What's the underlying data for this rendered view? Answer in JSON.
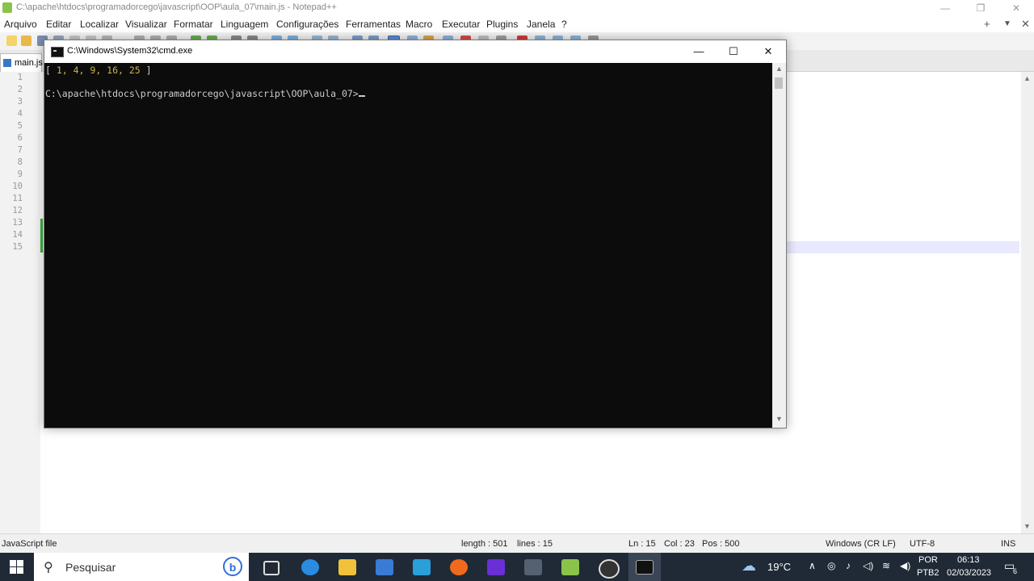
{
  "npp": {
    "title": "C:\\apache\\htdocs\\programadorcego\\javascript\\OOP\\aula_07\\main.js - Notepad++",
    "menu": [
      "Arquivo",
      "Editar",
      "Localizar",
      "Visualizar",
      "Formatar",
      "Linguagem",
      "Configurações",
      "Ferramentas",
      "Macro",
      "Executar",
      "Plugins",
      "Janela",
      "?"
    ],
    "menu_right": [
      "+",
      "▼",
      "✕"
    ],
    "tab_label": "main.js",
    "line_numbers": [
      "1",
      "2",
      "3",
      "4",
      "5",
      "6",
      "7",
      "8",
      "9",
      "10",
      "11",
      "12",
      "13",
      "14",
      "15"
    ],
    "status": {
      "filetype": "JavaScript file",
      "length": "length : 501",
      "lines": "lines : 15",
      "ln": "Ln : 15",
      "col": "Col : 23",
      "pos": "Pos : 500",
      "eol": "Windows (CR LF)",
      "encoding": "UTF-8",
      "mode": "INS"
    }
  },
  "cmd": {
    "title": "C:\\Windows\\System32\\cmd.exe",
    "output_open": "[ ",
    "output_values": "1, 4, 9, 16, 25",
    "output_close": " ]",
    "prompt": "C:\\apache\\htdocs\\programadorcego\\javascript\\OOP\\aula_07>"
  },
  "taskbar": {
    "search_placeholder": "Pesquisar",
    "bing_label": "b",
    "weather": "19°C",
    "lang_top": "POR",
    "lang_bottom": "PTB2",
    "time": "06:13",
    "date": "02/03/2023",
    "notification_count": "6"
  }
}
